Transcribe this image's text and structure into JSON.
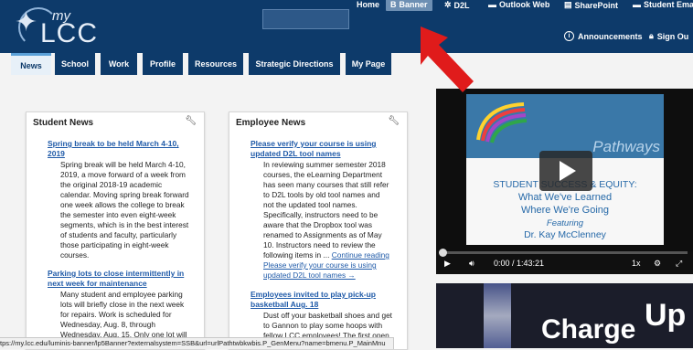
{
  "header": {
    "logo_my": "my",
    "logo_lcc": "LCC",
    "top_links": [
      "Home",
      "Banner",
      "D2L",
      "Outlook Web",
      "SharePoint",
      "Student Emai"
    ],
    "second_links": [
      "Announcements",
      "Sign Ou"
    ]
  },
  "tabs": [
    "News",
    "School",
    "Work",
    "Profile",
    "Resources",
    "Strategic Directions",
    "My Page"
  ],
  "student_news": {
    "title": "Student News",
    "items": [
      {
        "headline_lines": [
          "Spring break to be held March 4-10,",
          "2019"
        ],
        "body_lines": [
          "Spring break will be held March 4-10,",
          "2019, a move forward of a week from",
          "the original 2018-19 academic",
          "calendar. Moving spring break forward",
          "one week allows the college to break",
          "the semester into even eight-week",
          "segments, which is in the best interest",
          "of students and faculty, particularly",
          "those participating in eight-week",
          "courses."
        ]
      },
      {
        "headline_lines": [
          "Parking lots to close intermittently in",
          "next week for maintenance"
        ],
        "body_lines": [
          "Many student and employee parking",
          "lots will briefly close in the next week",
          "for repairs. Work is scheduled for",
          "Wednesday, Aug. 8, through",
          "Wednesday, Aug. 15. Only one lot will"
        ]
      }
    ]
  },
  "employee_news": {
    "title": "Employee News",
    "items": [
      {
        "headline_lines": [
          "Please verify your course is using",
          "updated D2L tool names"
        ],
        "body_lines": [
          "In reviewing summer semester 2018",
          "courses, the eLearning Department",
          "has seen many courses that still refer",
          "to D2L tools by old tool names and",
          "not the updated tool names.",
          "Specifically, instructors need to be",
          "aware that the Dropbox tool was",
          "renamed to Assignments as of May",
          "10. Instructors need to review the"
        ],
        "last_line_text": "following items in ...",
        "continue_link": "Continue reading",
        "more_lines": [
          "Please verify your course is using",
          "updated D2L tool names →"
        ]
      },
      {
        "headline_lines": [
          "Employees invited to play pick-up",
          "basketball Aug. 18"
        ],
        "body_lines": [
          "Dust off your basketball shoes and get",
          "to Gannon to play some hoops with",
          "fellow LCC employees! The first open"
        ]
      }
    ]
  },
  "video": {
    "slide_logo": "Pathways",
    "slide_line1": "STUDENT SUCCESS & EQUITY:",
    "slide_line2": "What We've Learned",
    "slide_line3": "Where We're Going",
    "slide_line4": "Featuring",
    "slide_line5": "Dr. Kay McClenney",
    "time": "0:00 / 1:43:21",
    "speed": "1x",
    "progress": 0
  },
  "video2": {
    "text1": "Charge",
    "text2": "Up"
  },
  "status_url": "tps://my.lcc.edu/luminis-banner/lp5Banner?externalsystem=SSB&url=urlPathtwbkwbis.P_GenMenu?name=bmenu.P_MainMnu",
  "colors": {
    "header": "#0d3a6a",
    "accent": "#5aa0d8",
    "link": "#1f5aa8",
    "arrow": "#e01b1b"
  }
}
